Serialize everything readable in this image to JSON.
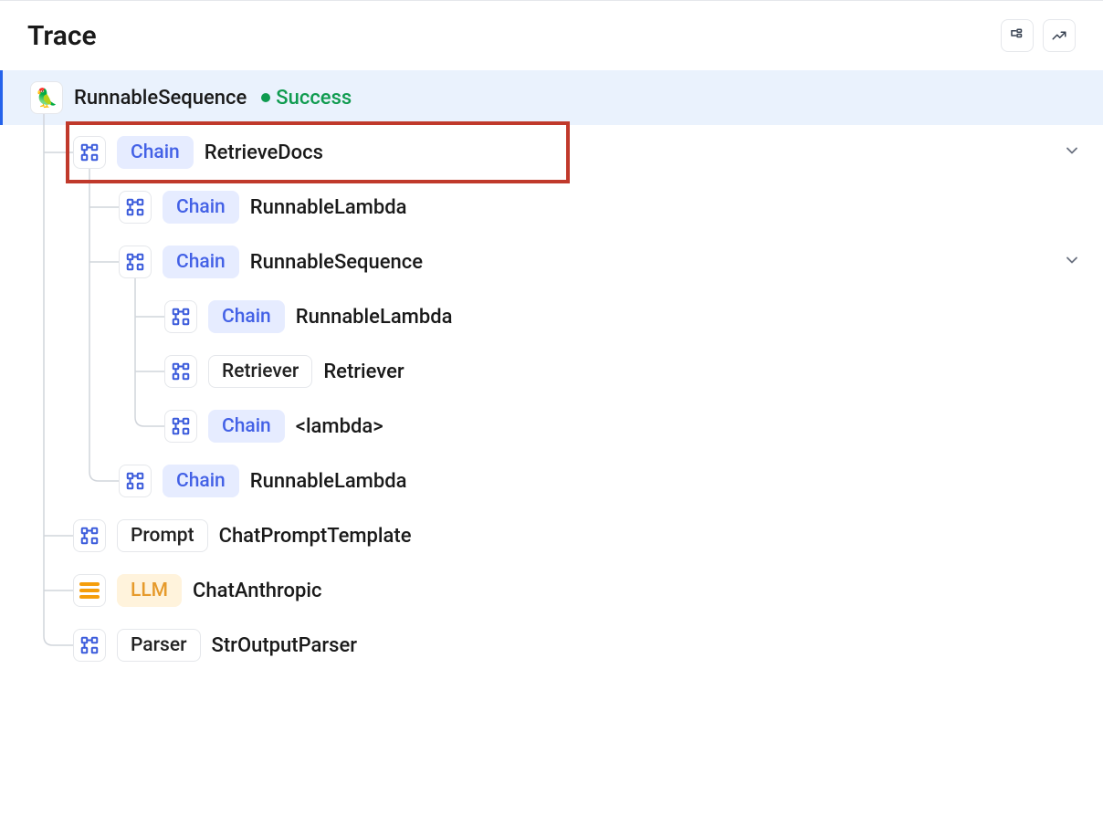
{
  "header": {
    "title": "Trace"
  },
  "root": {
    "name": "RunnableSequence",
    "status": "Success"
  },
  "nodes": [
    {
      "badge": "Chain",
      "badgeClass": "chain",
      "name": "RetrieveDocs",
      "indent": 1,
      "highlight": true,
      "expandable": true,
      "iconType": "chain"
    },
    {
      "badge": "Chain",
      "badgeClass": "chain",
      "name": "RunnableLambda",
      "indent": 2,
      "iconType": "chain"
    },
    {
      "badge": "Chain",
      "badgeClass": "chain",
      "name": "RunnableSequence",
      "indent": 2,
      "expandable": true,
      "iconType": "chain"
    },
    {
      "badge": "Chain",
      "badgeClass": "chain",
      "name": "RunnableLambda",
      "indent": 3,
      "iconType": "chain"
    },
    {
      "badge": "Retriever",
      "badgeClass": "retriever",
      "name": "Retriever",
      "indent": 3,
      "iconType": "chain"
    },
    {
      "badge": "Chain",
      "badgeClass": "chain",
      "name": "<lambda>",
      "indent": 3,
      "iconType": "chain"
    },
    {
      "badge": "Chain",
      "badgeClass": "chain",
      "name": "RunnableLambda",
      "indent": 2,
      "iconType": "chain"
    },
    {
      "badge": "Prompt",
      "badgeClass": "prompt",
      "name": "ChatPromptTemplate",
      "indent": 1,
      "iconType": "chain"
    },
    {
      "badge": "LLM",
      "badgeClass": "llm",
      "name": "ChatAnthropic",
      "indent": 1,
      "iconType": "llm"
    },
    {
      "badge": "Parser",
      "badgeClass": "parser",
      "name": "StrOutputParser",
      "indent": 1,
      "iconType": "chain"
    }
  ]
}
